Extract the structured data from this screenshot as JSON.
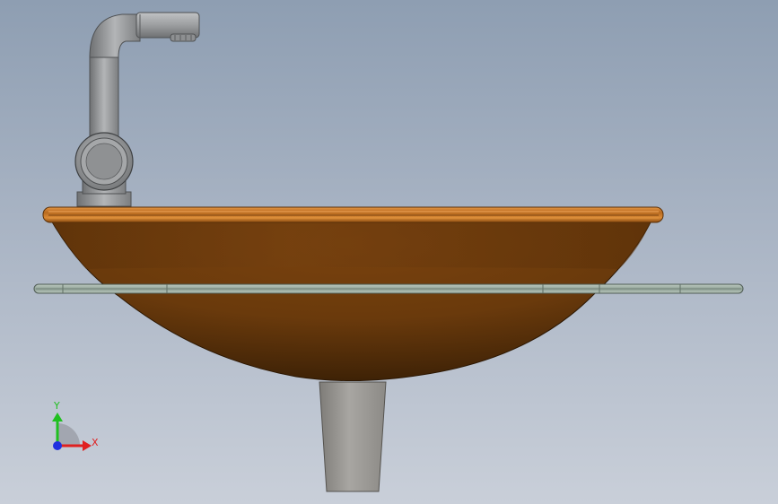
{
  "viewport": {
    "background_top": "#8e9eb2",
    "background_bottom": "#c9cfd9"
  },
  "model": {
    "basin_color": "#8a4c12",
    "rim_color": "#b86a1f",
    "faucet_color": "#9a9c9e",
    "pedestal_color": "#9e9c98",
    "glass_shelf_color": "#9fb0a6"
  },
  "triad": {
    "x_label": "X",
    "y_label": "Y",
    "x_color": "#e02020",
    "y_color": "#20c020",
    "z_color": "#2030e0"
  }
}
